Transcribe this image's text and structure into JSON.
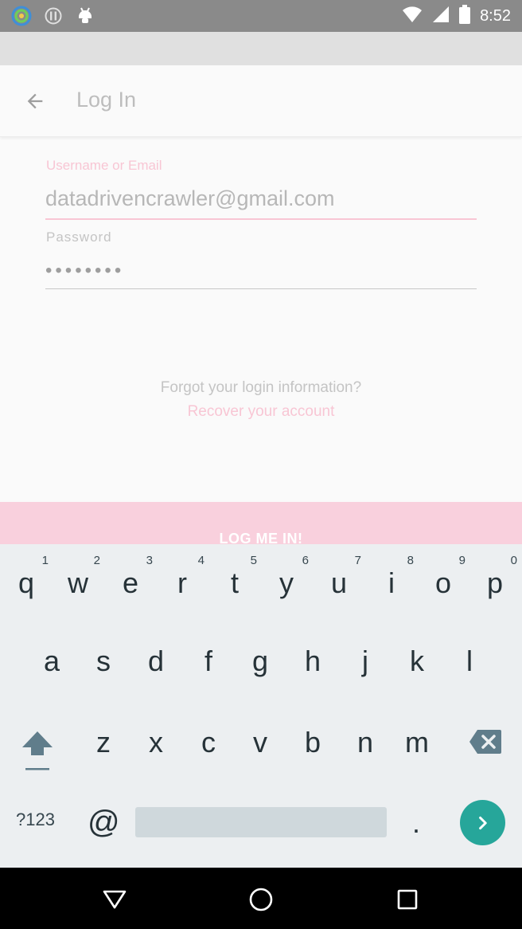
{
  "status_bar": {
    "time": "8:52",
    "icons_left": [
      "app-ring-icon",
      "alert-icon",
      "android-icon"
    ],
    "icons_right": [
      "wifi-icon",
      "signal-icon",
      "battery-icon"
    ]
  },
  "app_bar": {
    "title": "Log In",
    "back_icon": "arrow-back-icon"
  },
  "form": {
    "username_label": "Username or Email",
    "username_value": "datadrivencrawler@gmail.com",
    "password_label": "Password",
    "password_value": "••••••••"
  },
  "links": {
    "forgot": "Forgot your login information?",
    "recover": "Recover your account"
  },
  "login_button": "LOG ME IN!",
  "keyboard": {
    "row1": [
      {
        "ch": "q",
        "hint": "1"
      },
      {
        "ch": "w",
        "hint": "2"
      },
      {
        "ch": "e",
        "hint": "3"
      },
      {
        "ch": "r",
        "hint": "4"
      },
      {
        "ch": "t",
        "hint": "5"
      },
      {
        "ch": "y",
        "hint": "6"
      },
      {
        "ch": "u",
        "hint": "7"
      },
      {
        "ch": "i",
        "hint": "8"
      },
      {
        "ch": "o",
        "hint": "9"
      },
      {
        "ch": "p",
        "hint": "0"
      }
    ],
    "row2": [
      "a",
      "s",
      "d",
      "f",
      "g",
      "h",
      "j",
      "k",
      "l"
    ],
    "row3": [
      "z",
      "x",
      "c",
      "v",
      "b",
      "n",
      "m"
    ],
    "symbols": "?123",
    "at": "@",
    "period": "."
  },
  "colors": {
    "accent_pink": "#f8c6d4",
    "button_pink": "#f9d0dd",
    "enter_teal": "#26a69a"
  }
}
